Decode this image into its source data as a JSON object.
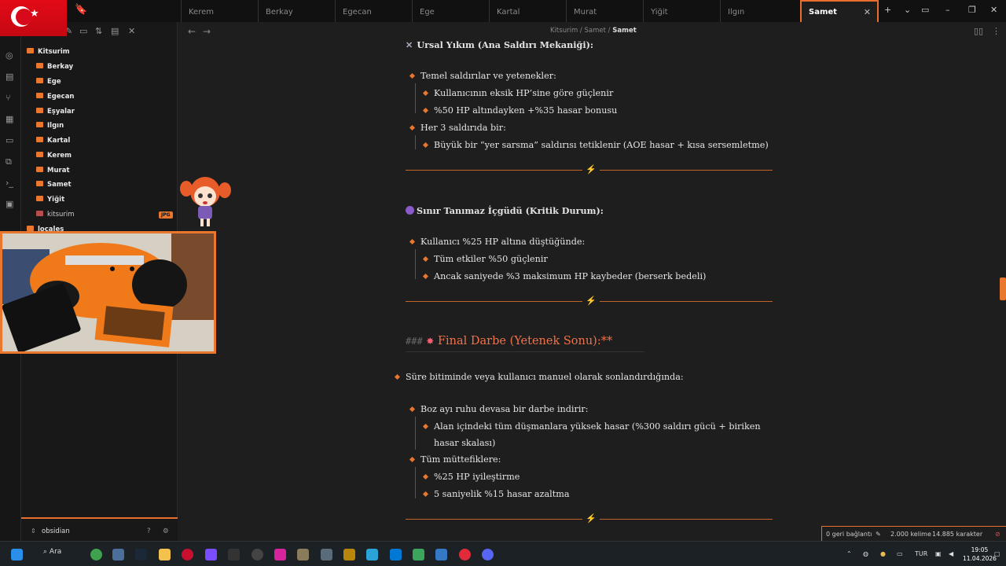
{
  "tabs": [
    "Kerem",
    "Berkay",
    "Egecan",
    "Ege",
    "Kartal",
    "Murat",
    "Yiğit",
    "Ilgın",
    "Samet"
  ],
  "active_tab": "Samet",
  "breadcrumb": {
    "root": "Kitsurim",
    "folder": "Samet",
    "file": "Samet"
  },
  "file_tree": {
    "root": "Kitsurim",
    "folders": [
      "Berkay",
      "Ege",
      "Egecan",
      "Eşyalar",
      "Ilgın",
      "Kartal",
      "Kerem",
      "Murat",
      "Samet",
      "Yiğit"
    ],
    "file": "kitsurim",
    "file_badge": "JPG",
    "next_folder": "locales"
  },
  "vault_name": "obsidian",
  "content": {
    "s1_title": "Ursal Yıkım (Ana Saldırı Mekaniği):",
    "s1_b1": "Temel saldırılar ve yetenekler:",
    "s1_b1a": "Kullanıcının eksik HP’sine göre güçlenir",
    "s1_b1b": "%50 HP altındayken +%35 hasar bonusu",
    "s1_b2": "Her 3 saldırıda bir:",
    "s1_b2a": "Büyük bir “yer sarsma” saldırısı tetiklenir (AOE hasar + kısa sersemletme)",
    "s2_title": "Sınır Tanımaz İçgüdü (Kritik Durum):",
    "s2_b1": "Kullanıcı %25 HP altına düştüğünde:",
    "s2_b1a": "Tüm etkiler %50 güçlenir",
    "s2_b1b": "Ancak saniyede %3 maksimum HP kaybeder (berserk bedeli)",
    "s3_hash": "###",
    "s3_title": "Final Darbe (Yetenek Sonu):**",
    "s3_intro": "Süre bitiminde veya kullanıcı manuel olarak sonlandırdığında:",
    "s3_b1": "Boz ayı ruhu devasa bir darbe indirir:",
    "s3_b1a_l1": "Alan içindeki tüm düşmanlara yüksek hasar (%300 saldırı gücü + biriken",
    "s3_b1a_l2": "hasar skalası)",
    "s3_b2": "Tüm müttefiklere:",
    "s3_b2a": "%25 HP iyileştirme",
    "s3_b2b": "5 saniyelik %15 hasar azaltma"
  },
  "status": {
    "backlinks": "0 geri bağlantı",
    "words": "2.000 kelime",
    "chars": "14.885 karakter"
  },
  "taskbar": {
    "search": "Ara",
    "lang": "TUR",
    "time": "19:05",
    "date": "11.04.2026"
  },
  "colors": {
    "accent": "#e9772d",
    "flag_red": "#e30a17"
  }
}
